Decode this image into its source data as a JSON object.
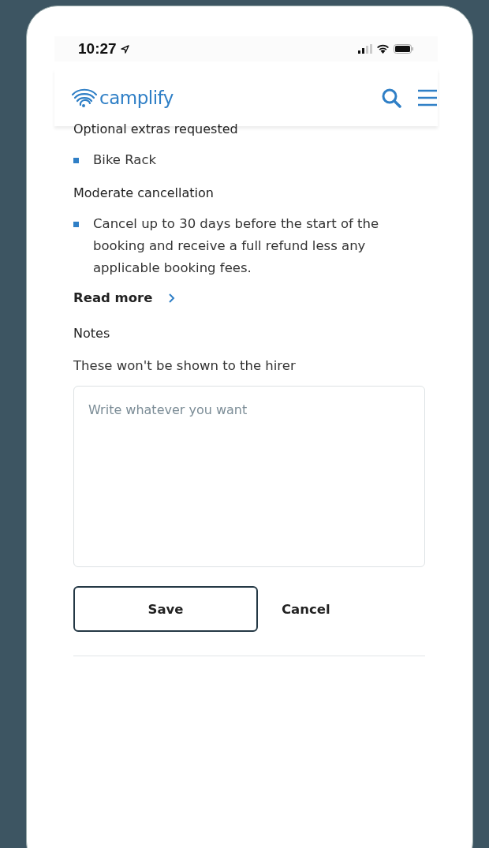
{
  "status_bar": {
    "time": "10:27"
  },
  "header": {
    "logo": "camplify"
  },
  "extras": {
    "title": "Optional extras requested",
    "items": [
      "Bike Rack"
    ]
  },
  "cancellation": {
    "title": "Moderate cancellation",
    "items": [
      "Cancel up to 30 days before the start of the booking and receive a full refund less any applicable booking fees."
    ],
    "link": "Read more"
  },
  "notes": {
    "title": "Notes",
    "hint": "These won't be shown to the hirer",
    "placeholder": "Write whatever you want"
  },
  "buttons": [
    {
      "label": "Save",
      "kind": "outline"
    },
    {
      "label": "Cancel",
      "kind": "text"
    }
  ]
}
